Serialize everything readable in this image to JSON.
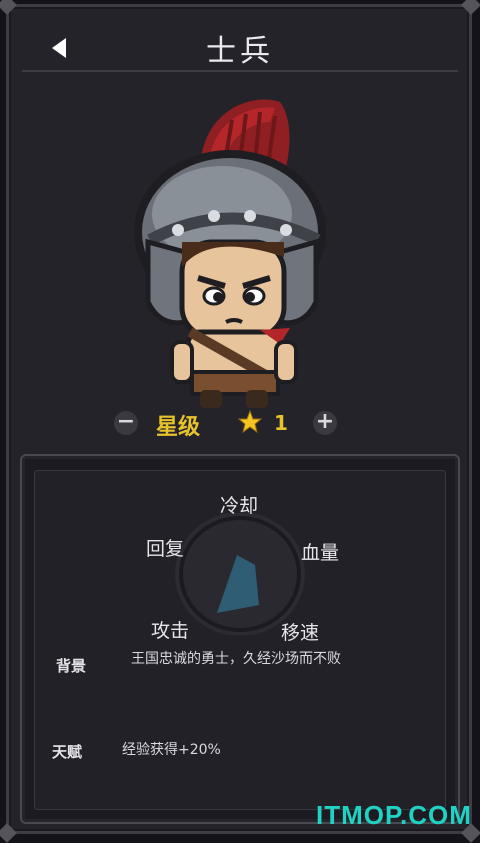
{
  "header": {
    "title": "士兵",
    "back_icon": "back-arrow-icon"
  },
  "character": {
    "name": "士兵",
    "portrait": "roman-soldier-character"
  },
  "star_level": {
    "label": "星级",
    "value": "1",
    "minus_label": "−",
    "plus_label": "+",
    "icon": "star-icon"
  },
  "stats": {
    "cooldown": "冷却",
    "recovery": "回复",
    "health": "血量",
    "attack": "攻击",
    "move_speed": "移速"
  },
  "info": {
    "background_key": "背景",
    "background_value": "王国忠诚的勇士，久经沙场而不败",
    "talent_key": "天赋",
    "talent_value": "经验获得+20%"
  },
  "watermark": "ITMOP.COM",
  "colors": {
    "accent_gold": "#e6c22b",
    "radar_fill": "#2f5d73",
    "watermark": "#1fd3c4"
  }
}
